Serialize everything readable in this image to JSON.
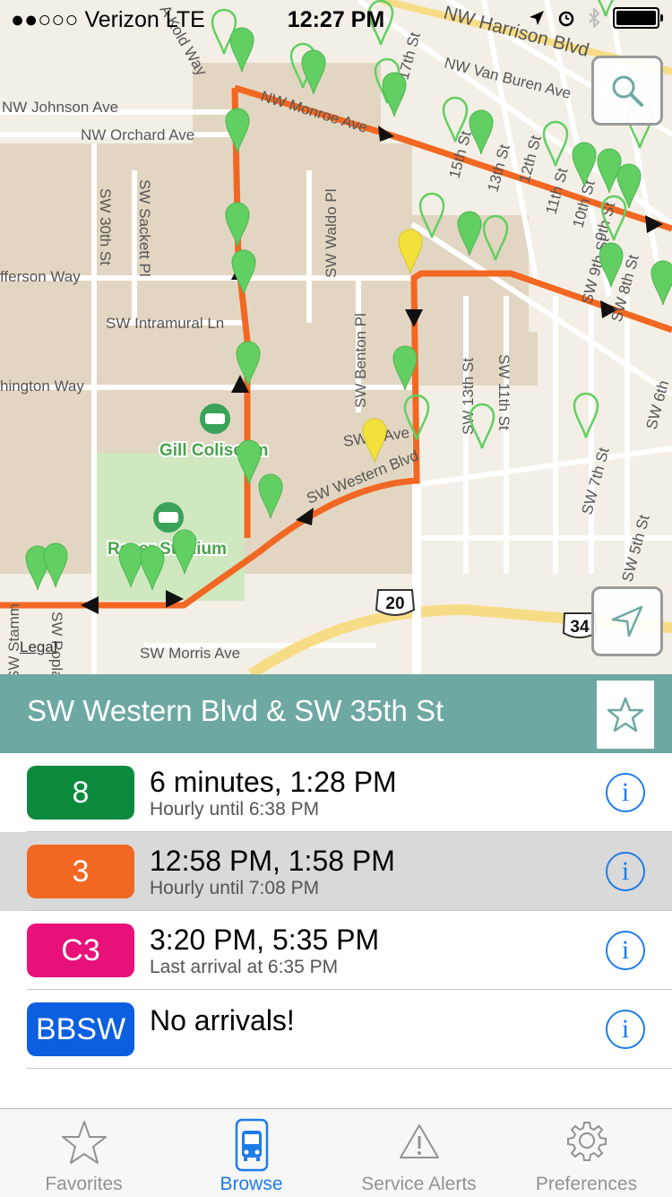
{
  "status_bar": {
    "carrier": "●●○○○ Verizon  LTE",
    "time": "12:27 PM"
  },
  "map": {
    "street_labels": [
      "NW Harrison Blvd",
      "NW Van Buren Ave",
      "NW Johnson Ave",
      "NW Orchard Ave",
      "NW Monroe Ave",
      "A Kold Way",
      "17th St",
      "15th St",
      "13th St",
      "12th St",
      "11th St",
      "10th St",
      "9th St",
      "SW 30th St",
      "SW Sackett Pl",
      "SW Waldo Pl",
      "fferson Way",
      "SW Intramural Ln",
      "hington Way",
      "SW Benton Pl",
      "SW 13th St",
      "SW 11th St",
      "SW A Ave",
      "SW Western Blvd",
      "SW 9th St",
      "SW 8th St",
      "SW 7th St",
      "SW 6th",
      "SW 5th St",
      "SW Morris Ave",
      "SW Popla",
      "SW Stamm"
    ],
    "poi_labels": [
      "Gill Coliseum",
      "Reser Stadium"
    ],
    "shields": [
      "20",
      "34"
    ],
    "legal": "Legal",
    "colors": {
      "route": "#f26722",
      "stop": "#62cf62",
      "selected_stop": "#f2e13a"
    }
  },
  "stop": {
    "name": "SW Western Blvd & SW 35th St"
  },
  "routes": [
    {
      "badge": "8",
      "color": "#0b8a3e",
      "times": "6 minutes, 1:28 PM",
      "detail": "Hourly until 6:38 PM",
      "selected": false
    },
    {
      "badge": "3",
      "color": "#f26722",
      "times": "12:58 PM, 1:58 PM",
      "detail": "Hourly until 7:08 PM",
      "selected": true
    },
    {
      "badge": "C3",
      "color": "#e8117a",
      "times": "3:20 PM, 5:35 PM",
      "detail": "Last arrival at 6:35 PM",
      "selected": false
    },
    {
      "badge": "BBSW",
      "color": "#0b5fe0",
      "times": "No arrivals!",
      "detail": "",
      "selected": false
    }
  ],
  "info_glyph": "i",
  "tabbar": {
    "tabs": [
      {
        "label": "Favorites",
        "icon": "star-icon",
        "active": false
      },
      {
        "label": "Browse",
        "icon": "bus-icon",
        "active": true
      },
      {
        "label": "Service Alerts",
        "icon": "warning-icon",
        "active": false
      },
      {
        "label": "Preferences",
        "icon": "gear-icon",
        "active": false
      }
    ]
  }
}
